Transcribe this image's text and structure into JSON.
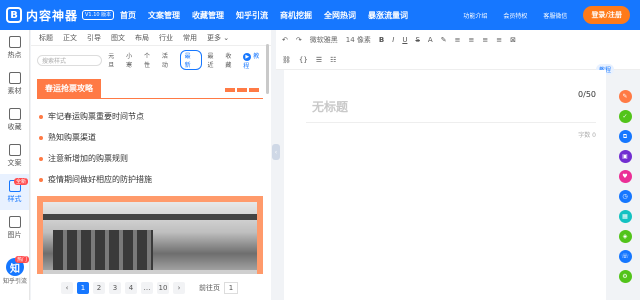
{
  "brand": {
    "logo_char": "B",
    "name": "内容神器",
    "version": "V1.10 版本"
  },
  "nav": [
    "首页",
    "文案管理",
    "收藏管理",
    "知乎引流",
    "商机挖掘",
    "全网热词",
    "暴涨流量词"
  ],
  "top_right": {
    "link1": "功能介绍",
    "link2": "会员特权",
    "link3": "客服微信",
    "login": "登录/注册"
  },
  "rail": [
    {
      "label": "热点",
      "icon": "power-icon"
    },
    {
      "label": "素材",
      "icon": "image-icon"
    },
    {
      "label": "收藏",
      "icon": "bookmark-icon"
    },
    {
      "label": "文案",
      "icon": "document-icon"
    },
    {
      "label": "样式",
      "icon": "style-icon"
    },
    {
      "label": "图片",
      "icon": "picture-icon"
    }
  ],
  "rail_badge": "全新",
  "zhihu": {
    "char": "知",
    "label": "知乎引流",
    "hot": "热门"
  },
  "style_tabs": [
    "标题",
    "正文",
    "引导",
    "图文",
    "布局",
    "行业",
    "常用",
    "更多"
  ],
  "filters": {
    "search_placeholder": "搜索样式",
    "chips": [
      "元旦",
      "小寒",
      "个性",
      "活动"
    ],
    "latest": "最新",
    "recent": "最近",
    "collect": "收藏",
    "tutorial": "教程"
  },
  "card": {
    "title": "春运抢票攻略",
    "items": [
      "牢记春运购票重要时间节点",
      "熟知购票渠道",
      "注意新增加的购票规则",
      "疫情期间做好相应的防护措施"
    ]
  },
  "pager": {
    "pages": [
      "1",
      "2",
      "3",
      "4",
      "…",
      "10"
    ],
    "prev": "‹",
    "next": "›",
    "goto": "前往页",
    "goto_value": "1"
  },
  "toolbar": {
    "font": "微软雅黑",
    "size": "14 像素",
    "row1_icons": [
      "↶",
      "↷"
    ],
    "format": [
      "B",
      "I",
      "U",
      "S"
    ]
  },
  "editor": {
    "title_placeholder": "无标题",
    "count": "0/50",
    "words": "字数 0",
    "tutorial": "教程"
  },
  "right_icons": [
    {
      "color": "#ff7a45",
      "icon": "edit-icon"
    },
    {
      "color": "#52c41a",
      "icon": "check-icon"
    },
    {
      "color": "#1677ff",
      "icon": "copy-icon"
    },
    {
      "color": "#722ed1",
      "icon": "gift-icon"
    },
    {
      "color": "#eb2f96",
      "icon": "heart-icon"
    },
    {
      "color": "#1677ff",
      "icon": "clock-icon"
    },
    {
      "color": "#13c2c2",
      "icon": "grid-icon"
    },
    {
      "color": "#52c41a",
      "icon": "bag-icon"
    },
    {
      "color": "#1677ff",
      "icon": "phone-icon"
    },
    {
      "color": "#52c41a",
      "icon": "settings-icon"
    }
  ]
}
